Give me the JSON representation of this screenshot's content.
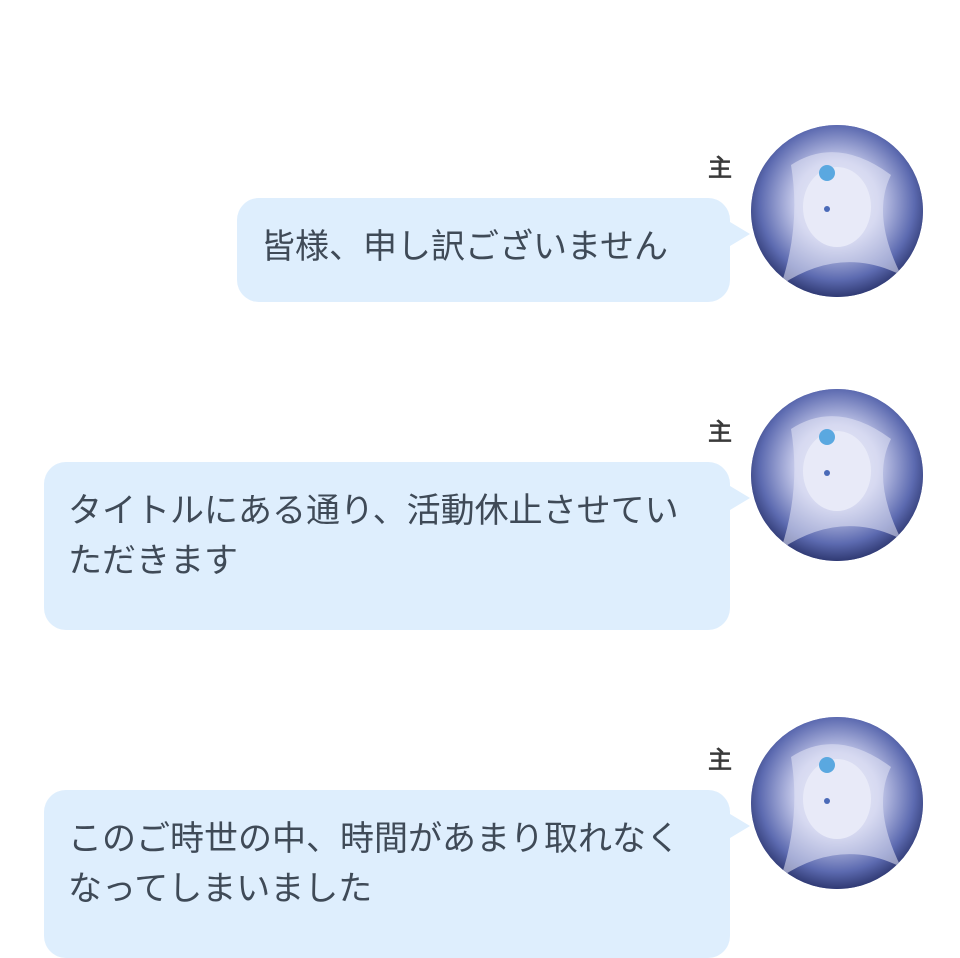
{
  "messages": [
    {
      "speaker": "主",
      "text": "皆様、申し訳ございません",
      "avatar": "character-avatar"
    },
    {
      "speaker": "主",
      "text": "タイトルにある通り、活動休止させていただきます",
      "avatar": "character-avatar"
    },
    {
      "speaker": "主",
      "text": "このご時世の中、時間があまり取れなくなってしまいました",
      "avatar": "character-avatar"
    }
  ],
  "colors": {
    "bubble": "#deeefd",
    "text": "#3f4a57",
    "speaker": "#3a3a3a"
  }
}
